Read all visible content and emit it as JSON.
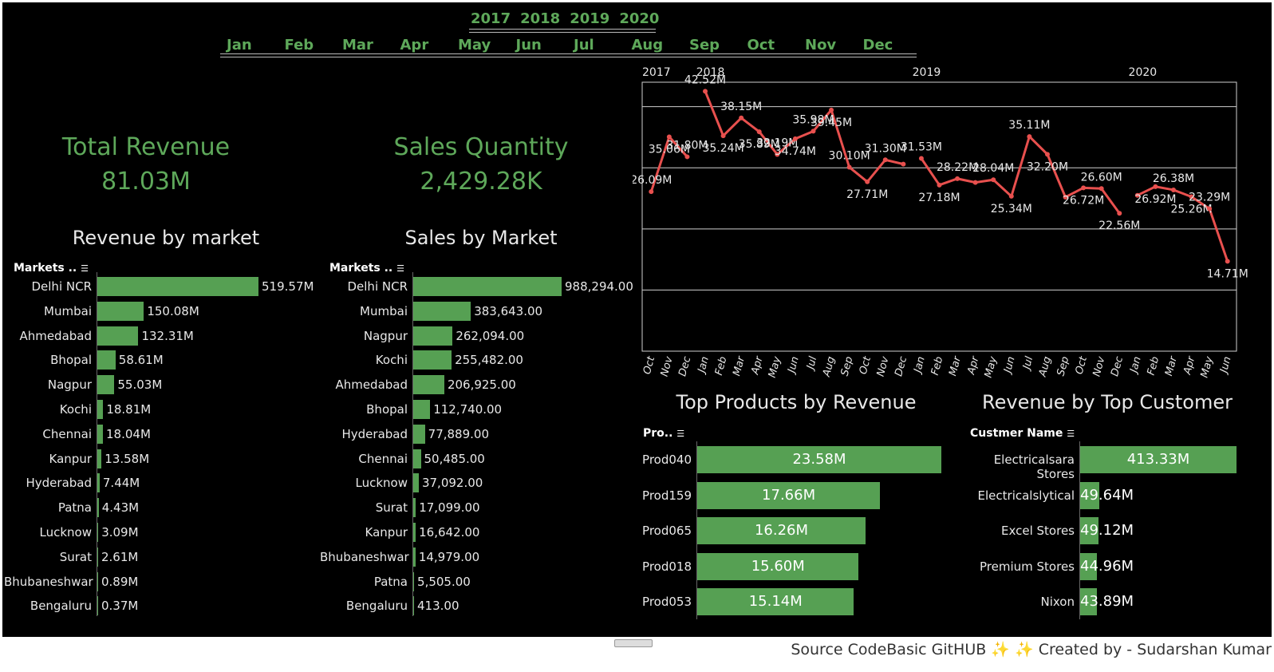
{
  "filters": {
    "years": [
      "2017",
      "2018",
      "2019",
      "2020"
    ],
    "months": [
      "Jan",
      "Feb",
      "Mar",
      "Apr",
      "May",
      "Jun",
      "Jul",
      "Aug",
      "Sep",
      "Oct",
      "Nov",
      "Dec"
    ]
  },
  "kpis": {
    "revenue_title": "Total Revenue",
    "revenue_value": "81.03M",
    "quantity_title": "Sales Quantity",
    "quantity_value": "2,429.28K"
  },
  "colors": {
    "accent": "#5ea85a",
    "bar": "#56a053",
    "line": "#e8504e",
    "background": "#000000"
  },
  "chart_data": [
    {
      "type": "bar",
      "orientation": "horizontal",
      "title": "Revenue by market",
      "header": "Markets ..",
      "categories": [
        "Delhi NCR",
        "Mumbai",
        "Ahmedabad",
        "Bhopal",
        "Nagpur",
        "Kochi",
        "Chennai",
        "Kanpur",
        "Hyderabad",
        "Patna",
        "Lucknow",
        "Surat",
        "Bhubaneshwar",
        "Bengaluru"
      ],
      "values": [
        519.57,
        150.08,
        132.31,
        58.61,
        55.03,
        18.81,
        18.04,
        13.58,
        7.44,
        4.43,
        3.09,
        2.61,
        0.89,
        0.37
      ],
      "labels": [
        "519.57M",
        "150.08M",
        "132.31M",
        "58.61M",
        "55.03M",
        "18.81M",
        "18.04M",
        "13.58M",
        "7.44M",
        "4.43M",
        "3.09M",
        "2.61M",
        "0.89M",
        "0.37M"
      ]
    },
    {
      "type": "bar",
      "orientation": "horizontal",
      "title": "Sales by Market",
      "header": "Markets ..",
      "categories": [
        "Delhi NCR",
        "Mumbai",
        "Nagpur",
        "Kochi",
        "Ahmedabad",
        "Bhopal",
        "Hyderabad",
        "Chennai",
        "Lucknow",
        "Surat",
        "Kanpur",
        "Bhubaneshwar",
        "Patna",
        "Bengaluru"
      ],
      "values": [
        988294,
        383643,
        262094,
        255482,
        206925,
        112740,
        77889,
        50485,
        37092,
        17099,
        16642,
        14979,
        5505,
        413
      ],
      "labels": [
        "988,294.00",
        "383,643.00",
        "262,094.00",
        "255,482.00",
        "206,925.00",
        "112,740.00",
        "77,889.00",
        "50,485.00",
        "37,092.00",
        "17,099.00",
        "16,642.00",
        "14,979.00",
        "5,505.00",
        "413.00"
      ]
    },
    {
      "type": "line",
      "title": "",
      "year_labels": [
        "2017",
        "2018",
        "2019",
        "2020"
      ],
      "segments": [
        {
          "year": "2017",
          "months": [
            "Oct",
            "Nov",
            "Dec"
          ],
          "values": [
            26.09,
            35.06,
            31.8
          ],
          "labels": [
            "26.09M",
            "35.06M",
            "31.80M"
          ]
        },
        {
          "year": "2018",
          "months": [
            "Jan",
            "Feb",
            "Mar",
            "Apr",
            "May",
            "Jun",
            "Jul",
            "Aug",
            "Sep",
            "Oct",
            "Nov",
            "Dec"
          ],
          "values": [
            42.52,
            35.24,
            38.15,
            35.89,
            32.19,
            34.74,
            35.98,
            39.45,
            30.1,
            27.71,
            31.3,
            30.6
          ],
          "labels": [
            "42.52M",
            "35.24M",
            "38.15M",
            "35.89M",
            "32.19M",
            "34.74M",
            "35.98M",
            "39.45M",
            "30.10M",
            "27.71M",
            "31.30M",
            ""
          ]
        },
        {
          "year": "2019",
          "months": [
            "Jan",
            "Feb",
            "Mar",
            "Apr",
            "May",
            "Jun",
            "Jul",
            "Aug",
            "Sep",
            "Oct",
            "Nov",
            "Dec"
          ],
          "values": [
            31.53,
            27.18,
            28.22,
            27.6,
            28.04,
            25.34,
            35.11,
            32.2,
            25.2,
            26.72,
            26.6,
            22.56
          ],
          "labels": [
            "31.53M",
            "27.18M",
            "28.22M",
            "",
            "28.04M",
            "25.34M",
            "35.11M",
            "32.20M",
            "",
            "26.72M",
            "26.60M",
            "22.56M"
          ]
        },
        {
          "year": "2020",
          "months": [
            "Jan",
            "Feb",
            "Mar",
            "Apr",
            "May",
            "Jun"
          ],
          "values": [
            25.5,
            26.92,
            26.38,
            25.26,
            23.29,
            14.71
          ],
          "labels": [
            "",
            "26.92M",
            "26.38M",
            "25.26M",
            "23.29M",
            "14.71M"
          ]
        }
      ],
      "ylim": [
        0,
        44
      ],
      "grid": true
    },
    {
      "type": "bar",
      "orientation": "horizontal",
      "title": "Top Products by Revenue",
      "header": "Pro..",
      "categories": [
        "Prod040",
        "Prod159",
        "Prod065",
        "Prod018",
        "Prod053"
      ],
      "values": [
        23.58,
        17.66,
        16.26,
        15.6,
        15.14
      ],
      "labels": [
        "23.58M",
        "17.66M",
        "16.26M",
        "15.60M",
        "15.14M"
      ]
    },
    {
      "type": "bar",
      "orientation": "horizontal",
      "title": "Revenue by Top Customer",
      "header": "Custmer Name",
      "categories": [
        "Electricalsara Stores",
        "Electricalslytical",
        "Excel Stores",
        "Premium Stores",
        "Nixon"
      ],
      "values": [
        413.33,
        49.64,
        49.12,
        44.96,
        43.89
      ],
      "labels": [
        "413.33M",
        "49.64M",
        "49.12M",
        "44.96M",
        "43.89M"
      ]
    }
  ],
  "footer": {
    "text": "Source CodeBasic GitHUB ✨ ✨ Created by - Sudarshan Kumar"
  }
}
